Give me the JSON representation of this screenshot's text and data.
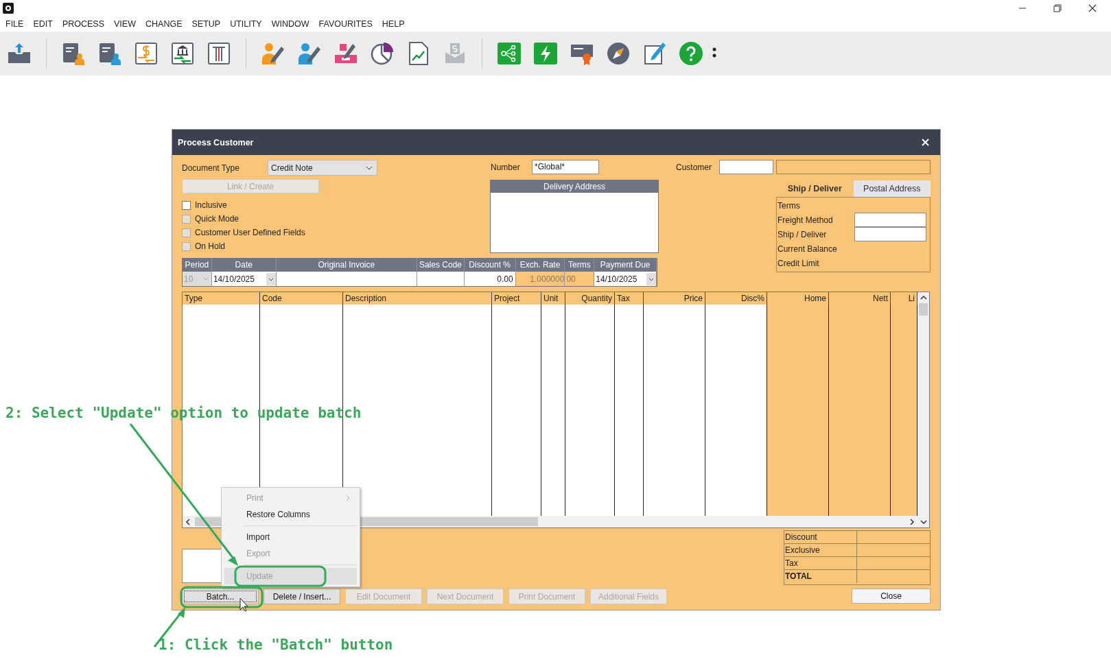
{
  "menu_bar": [
    "FILE",
    "EDIT",
    "PROCESS",
    "VIEW",
    "CHANGE",
    "SETUP",
    "UTILITY",
    "WINDOW",
    "FAVOURITES",
    "HELP"
  ],
  "dialog": {
    "title": "Process Customer",
    "document_type": {
      "label": "Document Type",
      "value": "Credit Note"
    },
    "link_button": {
      "label": "Link / Create",
      "disabled": true
    },
    "checkboxes": [
      {
        "label": "Inclusive",
        "checked": false,
        "disabled": false
      },
      {
        "label": "Quick Mode",
        "checked": false,
        "disabled": true
      },
      {
        "label": "Customer User Defined Fields",
        "checked": false,
        "disabled": true
      },
      {
        "label": "On Hold",
        "checked": false,
        "disabled": true
      }
    ],
    "number": {
      "label": "Number",
      "value": "*Global*"
    },
    "delivery_address": {
      "header": "Delivery Address"
    },
    "customer": {
      "label": "Customer"
    },
    "tabs": [
      {
        "label": "Ship / Deliver",
        "selected": true
      },
      {
        "label": "Postal Address",
        "selected": false
      }
    ],
    "ship_fields": [
      {
        "label": "Terms",
        "kind": "text"
      },
      {
        "label": "Freight Method",
        "kind": "input"
      },
      {
        "label": "Ship / Deliver",
        "kind": "input"
      },
      {
        "label": "Current Balance",
        "kind": "text"
      },
      {
        "label": "Credit Limit",
        "kind": "text"
      }
    ],
    "header_strip": {
      "columns": [
        "Period",
        "Date",
        "Original Invoice",
        "Sales Code",
        "Discount %",
        "Exch. Rate",
        "Terms",
        "Payment Due"
      ],
      "values": [
        {
          "text": "10",
          "kind": "dropdown",
          "disabled": true
        },
        {
          "text": "14/10/2025",
          "kind": "dropdown",
          "disabled": false
        },
        {
          "kind": "input",
          "disabled": false
        },
        {
          "kind": "input",
          "disabled": false
        },
        {
          "text": "0.00",
          "kind": "input",
          "disabled": false
        },
        {
          "text": "1.000000",
          "kind": "readonly",
          "disabled": false
        },
        {
          "text": "00",
          "kind": "readonly",
          "disabled": false
        },
        {
          "text": "14/10/2025",
          "kind": "dropdown",
          "disabled": false
        }
      ]
    },
    "grid": {
      "columns": [
        {
          "label": "Type",
          "read_only": false
        },
        {
          "label": "Code",
          "read_only": false
        },
        {
          "label": "Description",
          "read_only": false
        },
        {
          "label": "Project",
          "read_only": false
        },
        {
          "label": "Unit",
          "read_only": false
        },
        {
          "label": "Quantity",
          "read_only": false
        },
        {
          "label": "Tax",
          "read_only": false
        },
        {
          "label": "Price",
          "read_only": false
        },
        {
          "label": "Disc%",
          "read_only": false
        },
        {
          "label": "Home",
          "read_only": true
        },
        {
          "label": "Nett",
          "read_only": true
        },
        {
          "label": "Li",
          "read_only": true
        }
      ]
    },
    "totals": [
      {
        "label": "Discount",
        "kind": "line"
      },
      {
        "label": "Exclusive",
        "kind": "line"
      },
      {
        "label": "Tax",
        "kind": "line"
      },
      {
        "label": "TOTAL",
        "kind": "total"
      }
    ],
    "buttons": [
      {
        "label": "Batch...",
        "disabled": false,
        "focused": true
      },
      {
        "label": "Delete / Insert...",
        "disabled": false,
        "focused": false
      },
      {
        "label": "Edit Document",
        "disabled": true,
        "focused": false
      },
      {
        "label": "Next Document",
        "disabled": true,
        "focused": false
      },
      {
        "label": "Print Document",
        "disabled": true,
        "focused": false
      },
      {
        "label": "Additional Fields",
        "disabled": true,
        "focused": false
      }
    ],
    "close_button": {
      "label": "Close"
    },
    "context_menu": [
      {
        "kind": "item",
        "label": "Print",
        "disabled": true,
        "submenu": true,
        "selected": false
      },
      {
        "kind": "item",
        "label": "Restore Columns",
        "disabled": false,
        "submenu": false,
        "selected": false
      },
      {
        "kind": "separator"
      },
      {
        "kind": "item",
        "label": "Import",
        "disabled": false,
        "submenu": false,
        "selected": false
      },
      {
        "kind": "item",
        "label": "Export",
        "disabled": true,
        "submenu": false,
        "selected": false
      },
      {
        "kind": "separator"
      },
      {
        "kind": "item",
        "label": "Update",
        "disabled": true,
        "submenu": false,
        "selected": true
      }
    ]
  },
  "annotations": [
    {
      "text": "2: Select \"Update\" option to update batch"
    },
    {
      "text": "1: Click the \"Batch\" button"
    }
  ]
}
